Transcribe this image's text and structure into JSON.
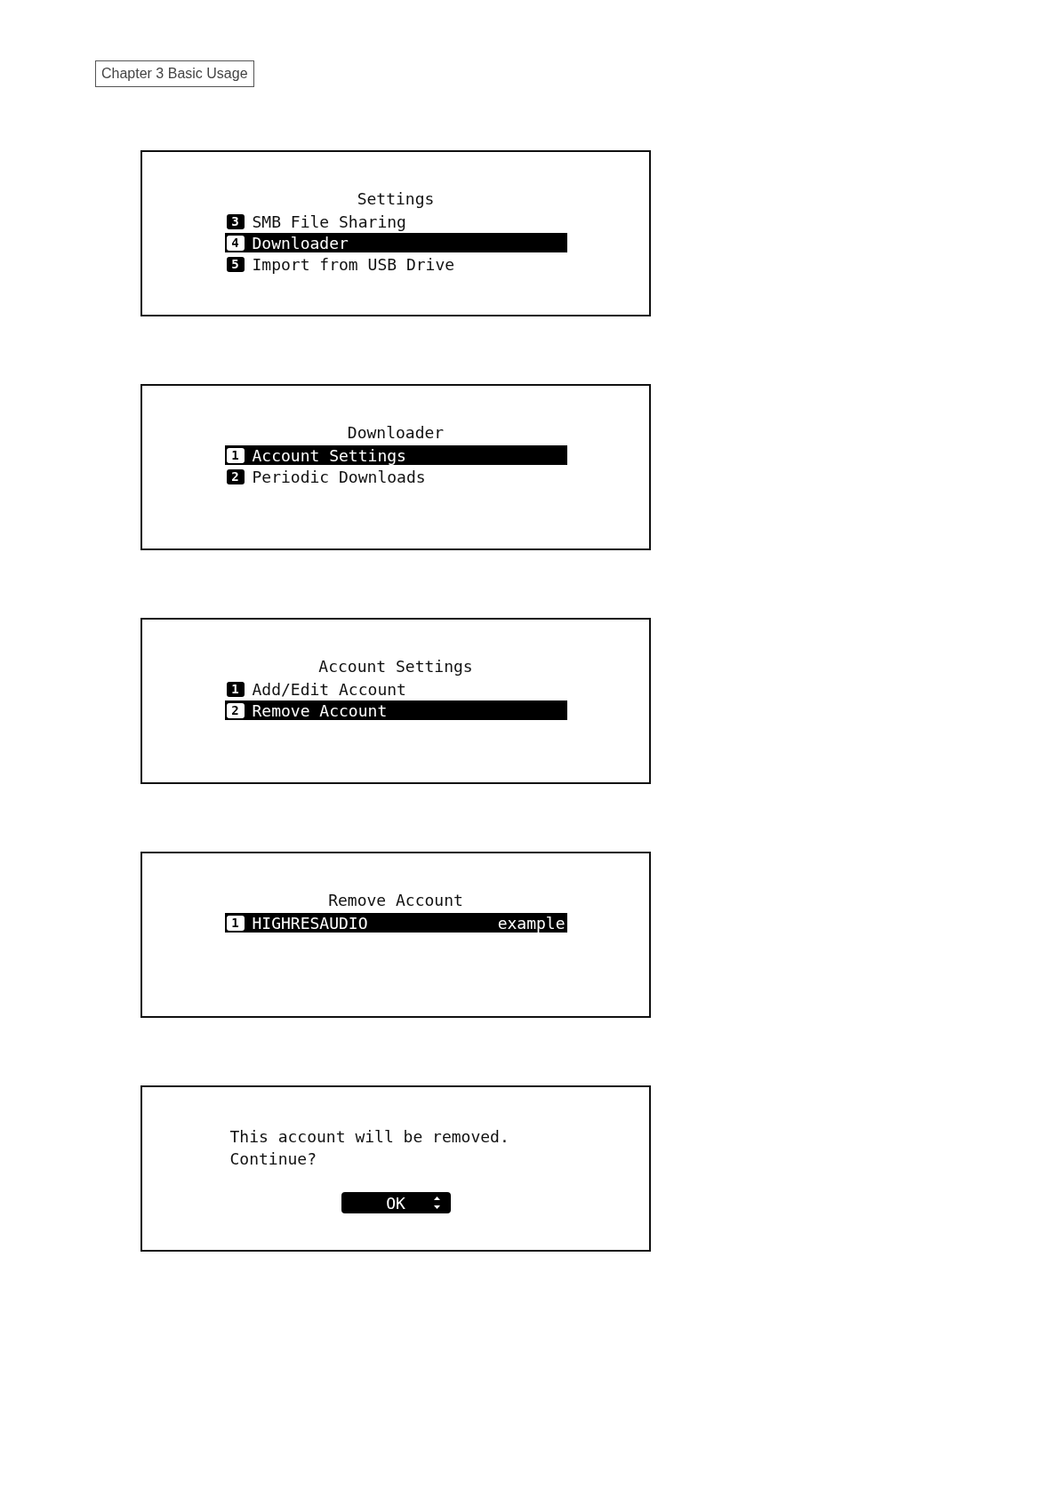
{
  "header": {
    "chapter_label": "Chapter 3 Basic Usage"
  },
  "screens": [
    {
      "kind": "menu",
      "title": "Settings",
      "items": [
        {
          "number": "3",
          "label": "SMB File Sharing",
          "selected": false
        },
        {
          "number": "4",
          "label": "Downloader",
          "selected": true
        },
        {
          "number": "5",
          "label": "Import from USB Drive",
          "selected": false
        }
      ]
    },
    {
      "kind": "menu",
      "title": "Downloader",
      "items": [
        {
          "number": "1",
          "label": "Account Settings",
          "selected": true
        },
        {
          "number": "2",
          "label": "Periodic Downloads",
          "selected": false
        }
      ]
    },
    {
      "kind": "menu",
      "title": "Account Settings",
      "items": [
        {
          "number": "1",
          "label": "Add/Edit Account",
          "selected": false
        },
        {
          "number": "2",
          "label": "Remove Account",
          "selected": true
        }
      ]
    },
    {
      "kind": "menu",
      "title": "Remove Account",
      "items": [
        {
          "number": "1",
          "label": "HIGHRESAUDIO",
          "value": "example",
          "selected": true
        }
      ]
    },
    {
      "kind": "confirm",
      "message_lines": [
        "This account will be removed.",
        "Continue?"
      ],
      "button": {
        "label": "OK"
      }
    }
  ]
}
